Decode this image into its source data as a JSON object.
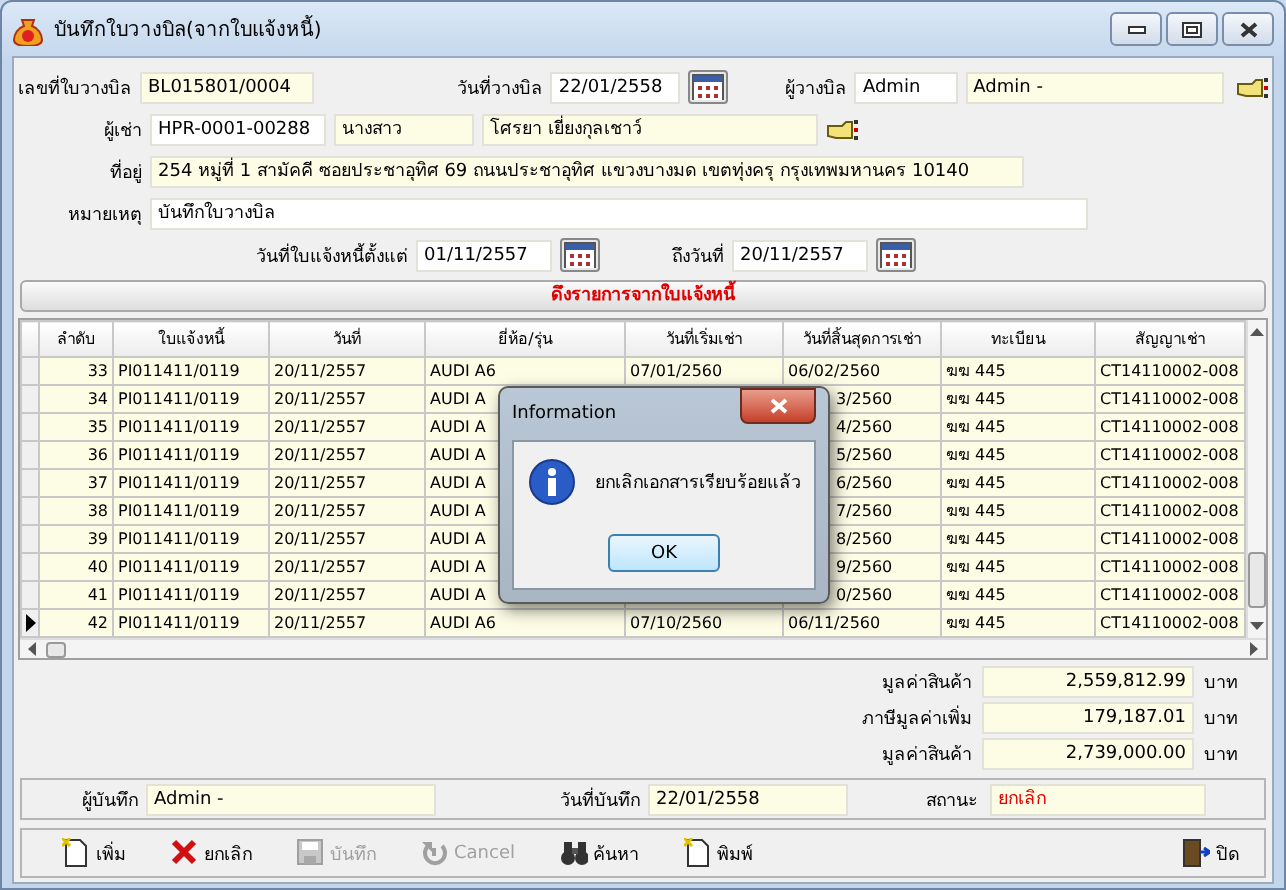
{
  "window": {
    "title": "บันทึกใบวางบิล(จากใบแจ้งหนี้)"
  },
  "form": {
    "bill_no": {
      "label": "เลขที่ใบวางบิล",
      "value": "BL015801/0004"
    },
    "bill_date": {
      "label": "วันที่วางบิล",
      "value": "22/01/2558"
    },
    "biller": {
      "label": "ผู้วางบิล",
      "code": "Admin",
      "name": "Admin -"
    },
    "tenant": {
      "label": "ผู้เช่า",
      "code": "HPR-0001-00288",
      "title": "นางสาว",
      "name": "โศรยา เยี่ยงกุลเชาว์"
    },
    "address": {
      "label": "ที่อยู่",
      "value": "254 หมู่ที่ 1 สามัคคี ซอยประชาอุทิศ 69 ถนนประชาอุทิศ แขวงบางมด เขตทุ่งครุ กรุงเทพมหานคร 10140"
    },
    "note": {
      "label": "หมายเหตุ",
      "value": "บันทึกใบวางบิล"
    },
    "from_date": {
      "label": "วันที่ใบแจ้งหนี้ตั้งแต่",
      "value": "01/11/2557"
    },
    "to_date": {
      "label": "ถึงวันที่",
      "value": "20/11/2557"
    }
  },
  "pull_button": "ดึงรายการจากใบแจ้งหนี้",
  "table": {
    "columns": [
      "ลำดับ",
      "ใบแจ้งหนี้",
      "วันที่",
      "ยี่ห้อ/รุ่น",
      "วันที่เริ่มเช่า",
      "วันที่สิ้นสุดการเช่า",
      "ทะเบียน",
      "สัญญาเช่า"
    ],
    "rows": [
      {
        "selected": false,
        "cells": [
          "33",
          "PI011411/0119",
          "20/11/2557",
          "AUDI A6",
          "07/01/2560",
          "06/02/2560",
          "ฆฆ 445",
          "CT14110002-008"
        ]
      },
      {
        "selected": false,
        "cells": [
          "34",
          "PI011411/0119",
          "20/11/2557",
          "AUDI A",
          null,
          "3/2560",
          "ฆฆ 445",
          "CT14110002-008"
        ]
      },
      {
        "selected": false,
        "cells": [
          "35",
          "PI011411/0119",
          "20/11/2557",
          "AUDI A",
          null,
          "4/2560",
          "ฆฆ 445",
          "CT14110002-008"
        ]
      },
      {
        "selected": false,
        "cells": [
          "36",
          "PI011411/0119",
          "20/11/2557",
          "AUDI A",
          null,
          "5/2560",
          "ฆฆ 445",
          "CT14110002-008"
        ]
      },
      {
        "selected": false,
        "cells": [
          "37",
          "PI011411/0119",
          "20/11/2557",
          "AUDI A",
          null,
          "6/2560",
          "ฆฆ 445",
          "CT14110002-008"
        ]
      },
      {
        "selected": false,
        "cells": [
          "38",
          "PI011411/0119",
          "20/11/2557",
          "AUDI A",
          null,
          "7/2560",
          "ฆฆ 445",
          "CT14110002-008"
        ]
      },
      {
        "selected": false,
        "cells": [
          "39",
          "PI011411/0119",
          "20/11/2557",
          "AUDI A",
          null,
          "8/2560",
          "ฆฆ 445",
          "CT14110002-008"
        ]
      },
      {
        "selected": false,
        "cells": [
          "40",
          "PI011411/0119",
          "20/11/2557",
          "AUDI A",
          null,
          "9/2560",
          "ฆฆ 445",
          "CT14110002-008"
        ]
      },
      {
        "selected": false,
        "cells": [
          "41",
          "PI011411/0119",
          "20/11/2557",
          "AUDI A",
          null,
          "0/2560",
          "ฆฆ 445",
          "CT14110002-008"
        ]
      },
      {
        "selected": true,
        "cells": [
          "42",
          "PI011411/0119",
          "20/11/2557",
          "AUDI A6",
          "07/10/2560",
          "06/11/2560",
          "ฆฆ 445",
          "CT14110002-008"
        ]
      }
    ]
  },
  "totals": [
    {
      "label": "มูลค่าสินค้า",
      "value": "2,559,812.99",
      "unit": "บาท"
    },
    {
      "label": "ภาษีมูลค่าเพิ่ม",
      "value": "179,187.01",
      "unit": "บาท"
    },
    {
      "label": "มูลค่าสินค้า",
      "value": "2,739,000.00",
      "unit": "บาท"
    }
  ],
  "footer": {
    "recorder": {
      "label": "ผู้บันทึก",
      "value": "Admin -"
    },
    "record_date": {
      "label": "วันที่บันทึก",
      "value": "22/01/2558"
    },
    "status": {
      "label": "สถานะ",
      "value": "ยกเลิก"
    }
  },
  "toolbar": [
    {
      "kind": "new",
      "label": "เพิ่ม",
      "disabled": false
    },
    {
      "kind": "delete",
      "label": "ยกเลิก",
      "disabled": false
    },
    {
      "kind": "save",
      "label": "บันทึก",
      "disabled": true
    },
    {
      "kind": "undo",
      "label": "Cancel",
      "disabled": true
    },
    {
      "kind": "search",
      "label": "ค้นหา",
      "disabled": false
    },
    {
      "kind": "print",
      "label": "พิมพ์",
      "disabled": false
    },
    {
      "kind": "exit",
      "label": "ปิด",
      "disabled": false
    }
  ],
  "dialog": {
    "title": "Information",
    "message": "ยกเลิกเอกสารเรียบร้อยแล้ว",
    "button": "OK"
  }
}
